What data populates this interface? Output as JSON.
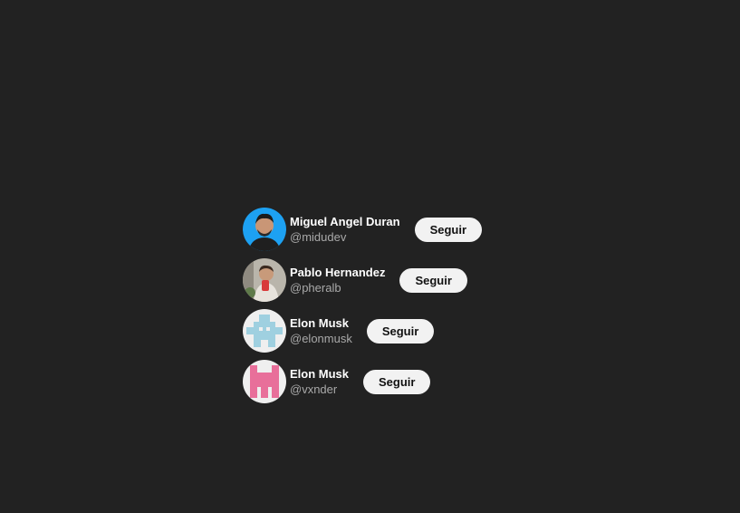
{
  "users": [
    {
      "name": "Miguel Angel Duran",
      "handle": "@midudev",
      "button": "Seguir"
    },
    {
      "name": "Pablo Hernandez",
      "handle": "@pheralb",
      "button": "Seguir"
    },
    {
      "name": "Elon Musk",
      "handle": "@elonmusk",
      "button": "Seguir"
    },
    {
      "name": "Elon Musk",
      "handle": "@vxnder",
      "button": "Seguir"
    }
  ]
}
